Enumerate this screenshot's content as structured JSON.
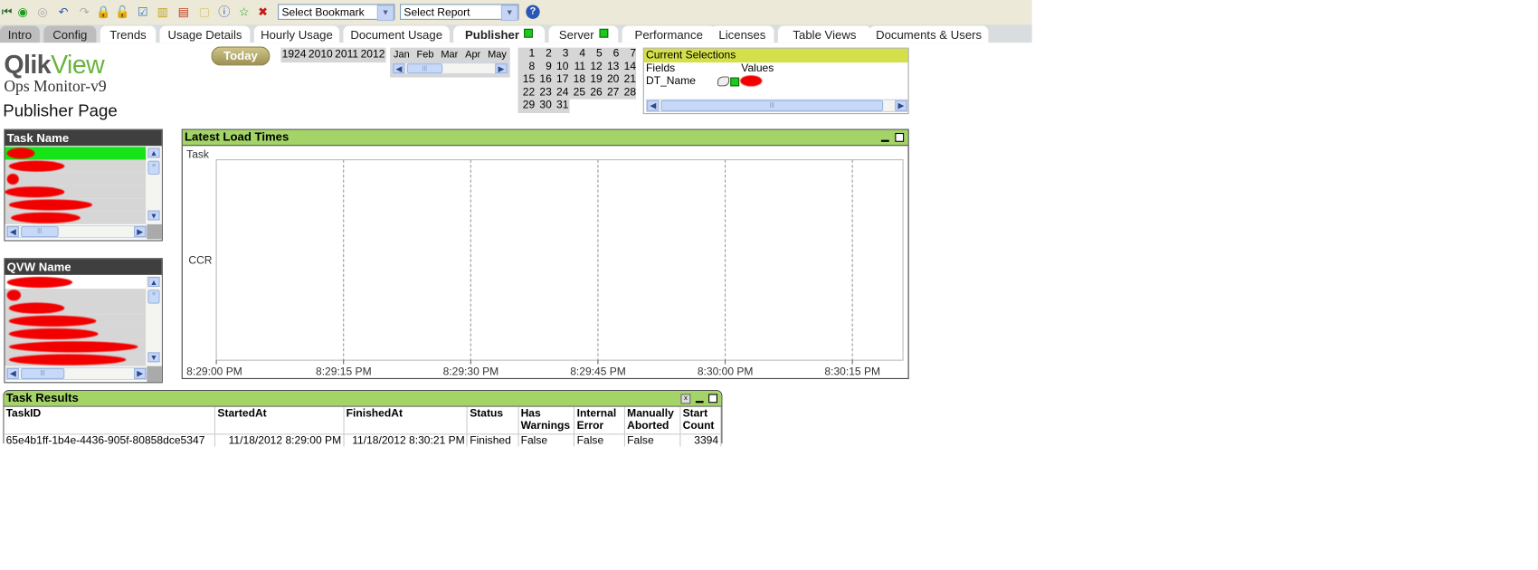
{
  "toolbar": {
    "icons": [
      "first-icon",
      "back-icon",
      "forward-icon",
      "undo-icon",
      "redo-icon",
      "lock-icon",
      "unlock-icon",
      "checkbox-icon",
      "chart-wizard-icon",
      "bar-chart-icon",
      "new-sheet-icon",
      "info-icon",
      "bookmark-star-icon",
      "remove-bookmark-icon"
    ],
    "bookmark_select": "Select Bookmark",
    "report_select": "Select Report",
    "help": "?"
  },
  "tabs": [
    {
      "label": "Intro"
    },
    {
      "label": "Config"
    },
    {
      "label": "Trends"
    },
    {
      "label": "Usage Details"
    },
    {
      "label": "Hourly Usage"
    },
    {
      "label": "Document Usage"
    },
    {
      "label": "Publisher",
      "status": "green",
      "active": true
    },
    {
      "label": "Server",
      "status": "green"
    },
    {
      "label": "Performance"
    },
    {
      "label": "Licenses"
    },
    {
      "label": "Table Views"
    },
    {
      "label": "Documents & Users"
    }
  ],
  "header": {
    "logo_qlik": "Qlik",
    "logo_view": "View",
    "subtitle": "Ops Monitor-v9",
    "page_title": "Publisher Page",
    "today_button": "Today"
  },
  "years": [
    "1924",
    "2010",
    "2011",
    "2012"
  ],
  "months": [
    "Jan",
    "Feb",
    "Mar",
    "Apr",
    "May"
  ],
  "days": [
    "1",
    "2",
    "3",
    "4",
    "5",
    "6",
    "7",
    "8",
    "9",
    "10",
    "11",
    "12",
    "13",
    "14",
    "15",
    "16",
    "17",
    "18",
    "19",
    "20",
    "21",
    "22",
    "23",
    "24",
    "25",
    "26",
    "27",
    "28",
    "29",
    "30",
    "31"
  ],
  "current_selections": {
    "title": "Current Selections",
    "col_fields": "Fields",
    "col_values": "Values",
    "rows": [
      {
        "field": "DT_Name"
      }
    ]
  },
  "task_name_box": {
    "title": "Task Name"
  },
  "qvw_name_box": {
    "title": "QVW Name"
  },
  "chart_data": {
    "type": "bar",
    "title": "Latest Load Times",
    "ylabel": "Task",
    "categories": [
      "CCR"
    ],
    "x_ticks": [
      "8:29:00 PM",
      "8:29:15 PM",
      "8:29:30 PM",
      "8:29:45 PM",
      "8:30:00 PM",
      "8:30:15 PM"
    ],
    "grid": true
  },
  "task_results": {
    "title": "Task Results",
    "columns": [
      "TaskID",
      "StartedAt",
      "FinishedAt",
      "Status",
      "Has Warnings",
      "Internal Error",
      "Manually Aborted",
      "Start Count"
    ],
    "rows": [
      [
        "65e4b1ff-1b4e-4436-905f-80858dce5347",
        "11/18/2012 8:29:00 PM",
        "11/18/2012 8:30:21 PM",
        "Finished",
        "False",
        "False",
        "False",
        "3394"
      ]
    ]
  },
  "colors": {
    "caption_green": "#a4d468",
    "selected_green": "#16e416",
    "selections_header": "#d4e04a"
  }
}
